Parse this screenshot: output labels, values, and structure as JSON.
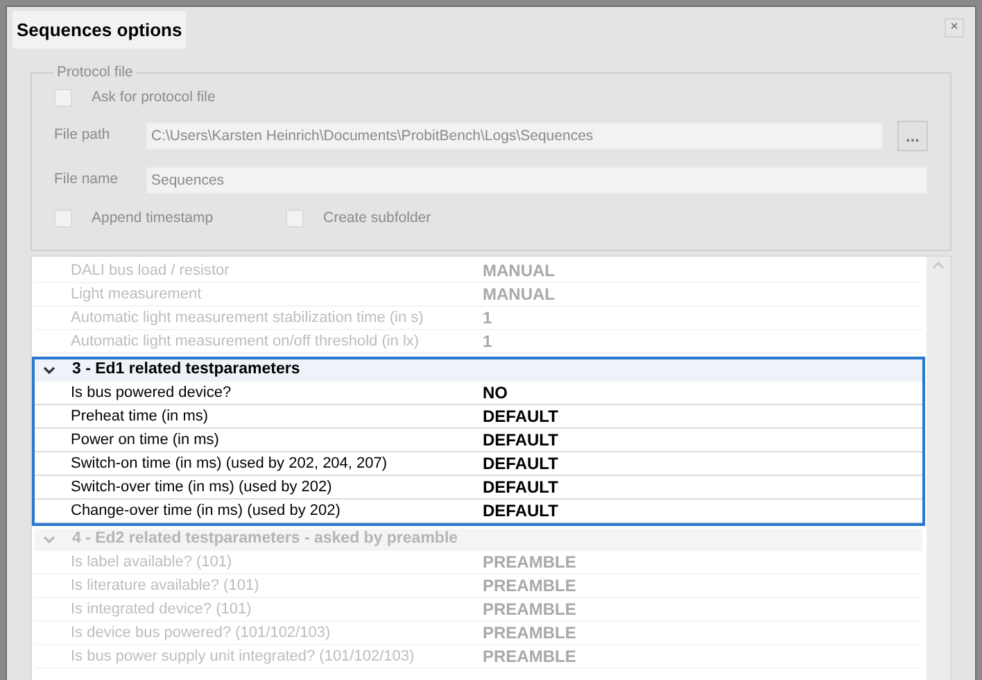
{
  "window": {
    "title": "Sequences options",
    "close": "×"
  },
  "protocol_file": {
    "legend": "Protocol file",
    "ask_checkbox": {
      "label": "Ask for protocol file",
      "checked": false
    },
    "file_path": {
      "label": "File path",
      "value": "C:\\Users\\Karsten Heinrich\\Documents\\ProbitBench\\Logs\\Sequences",
      "browse": "..."
    },
    "file_name": {
      "label": "File name",
      "value": "Sequences"
    },
    "append_timestamp": {
      "label": "Append timestamp",
      "checked": false
    },
    "create_subfolder": {
      "label": "Create subfolder",
      "checked": false
    }
  },
  "property_grid": {
    "sections": [
      {
        "highlighted": false,
        "rows": [
          {
            "name": "DALI bus load / resistor",
            "value": "MANUAL"
          },
          {
            "name": "Light measurement",
            "value": "MANUAL"
          },
          {
            "name": "Automatic light measurement stabilization time (in s)",
            "value": "1"
          },
          {
            "name": "Automatic light measurement on/off threshold (in lx)",
            "value": "1"
          }
        ]
      },
      {
        "title": "3 - Ed1 related testparameters",
        "expanded": true,
        "highlighted": true,
        "rows": [
          {
            "name": "Is bus powered device?",
            "value": "NO"
          },
          {
            "name": "Preheat time (in ms)",
            "value": "DEFAULT"
          },
          {
            "name": "Power on time (in ms)",
            "value": "DEFAULT"
          },
          {
            "name": "Switch-on time (in ms) (used by 202, 204, 207)",
            "value": "DEFAULT"
          },
          {
            "name": "Switch-over time (in ms) (used by 202)",
            "value": "DEFAULT"
          },
          {
            "name": "Change-over time (in ms) (used by 202)",
            "value": "DEFAULT"
          }
        ]
      },
      {
        "title": "4 - Ed2 related testparameters - asked by preamble",
        "expanded": true,
        "highlighted": false,
        "rows": [
          {
            "name": "Is label available? (101)",
            "value": "PREAMBLE"
          },
          {
            "name": "Is literature available? (101)",
            "value": "PREAMBLE"
          },
          {
            "name": "Is integrated device? (101)",
            "value": "PREAMBLE"
          },
          {
            "name": "Is device bus powered? (101/102/103)",
            "value": "PREAMBLE"
          },
          {
            "name": "Is bus power supply unit integrated? (101/102/103)",
            "value": "PREAMBLE"
          }
        ]
      }
    ]
  }
}
